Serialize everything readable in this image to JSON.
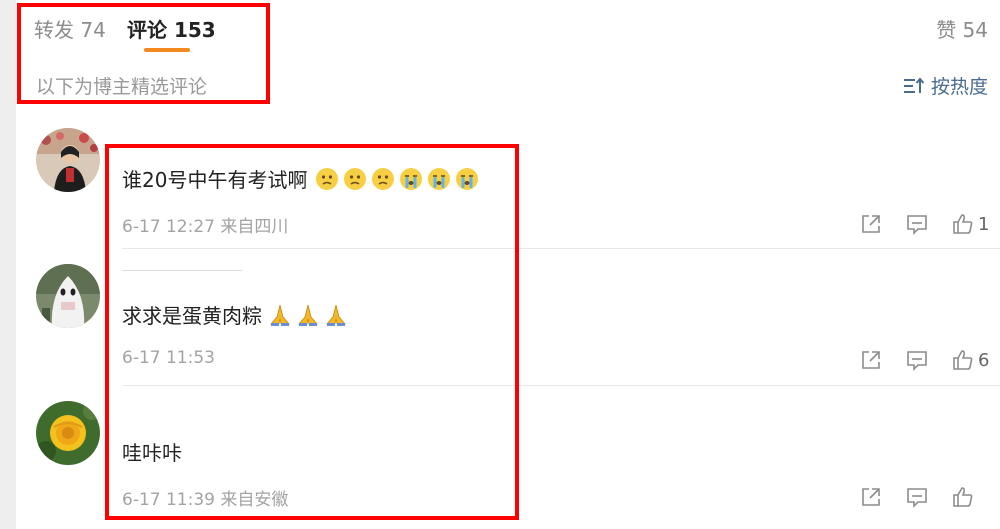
{
  "tabs": {
    "repost": "转发 74",
    "comment": "评论 153",
    "like": "赞 54"
  },
  "subheader": {
    "filter_note": "以下为博主精选评论",
    "sort_label": "按热度"
  },
  "comments": [
    {
      "text": "谁20号中午有考试啊",
      "emojis": [
        "worried-face",
        "worried-face",
        "worried-face",
        "crying-face",
        "crying-face",
        "crying-face"
      ],
      "meta": "6-17 12:27 来自四川",
      "likes": "1"
    },
    {
      "text": "求求是蛋黄肉粽",
      "emojis": [
        "folded-hands",
        "folded-hands",
        "folded-hands"
      ],
      "meta": "6-17 11:53",
      "likes": "6"
    },
    {
      "text": "哇咔咔",
      "emojis": [],
      "meta": "6-17 11:39 来自安徽",
      "likes": ""
    }
  ],
  "colors": {
    "accent": "#f28a1d",
    "link": "#4a6a8f",
    "highlight": "#ff0000"
  }
}
